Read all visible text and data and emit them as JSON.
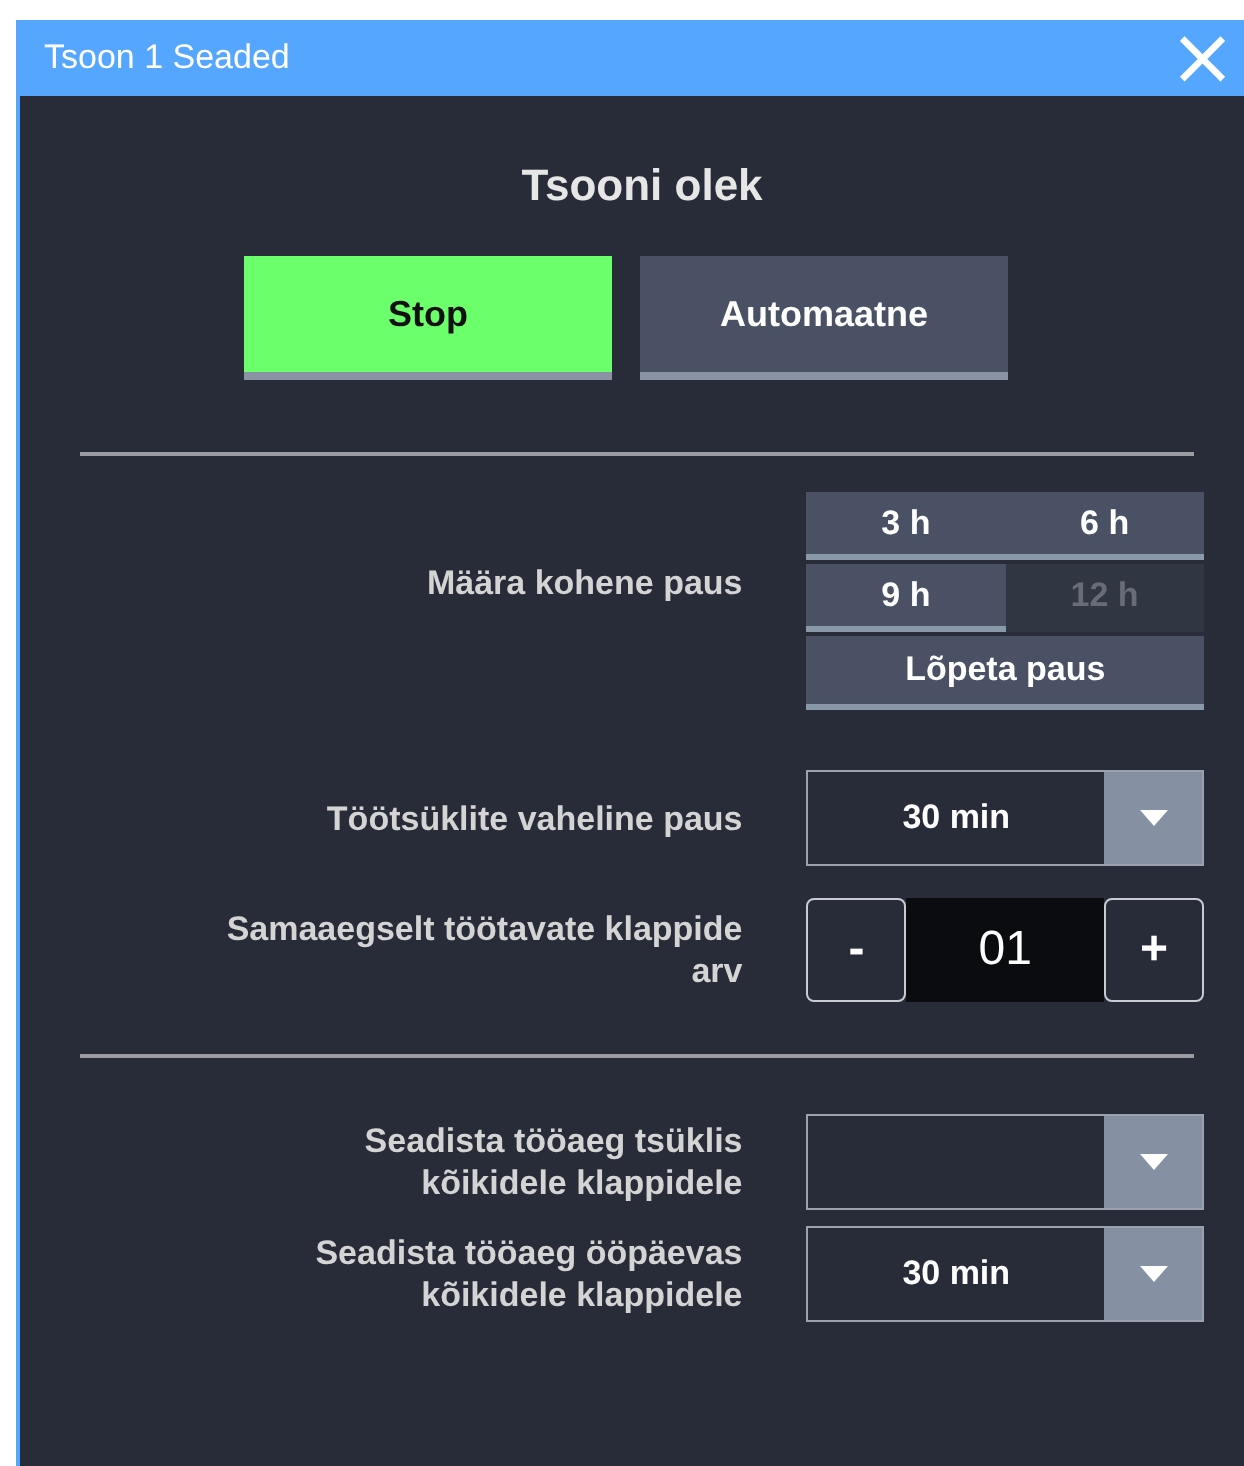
{
  "window": {
    "title": "Tsoon 1 Seaded",
    "close": "×"
  },
  "state": {
    "heading": "Tsooni olek",
    "buttons": [
      {
        "label": "Stop",
        "selected": true
      },
      {
        "label": "Automaatne",
        "selected": false
      }
    ]
  },
  "pause": {
    "label": "Määra kohene paus",
    "options": [
      {
        "label": "3 h",
        "disabled": false
      },
      {
        "label": "6 h",
        "disabled": false
      },
      {
        "label": "9 h",
        "disabled": false
      },
      {
        "label": "12 h",
        "disabled": true
      }
    ],
    "end_button": "Lõpeta paus"
  },
  "cycle_pause": {
    "label": "Töötsüklite vaheline paus",
    "value": "30 min"
  },
  "valves": {
    "label": "Samaaegselt töötavate klappide\narv",
    "minus": "-",
    "value": "01",
    "plus": "+"
  },
  "settings": [
    {
      "label": "Seadista tööaeg tsüklis\nkõikidele klappidele"
    },
    {
      "label": "Seadista tööaeg ööpäevas\nkõikidele klappidele",
      "value": "30 min"
    }
  ]
}
